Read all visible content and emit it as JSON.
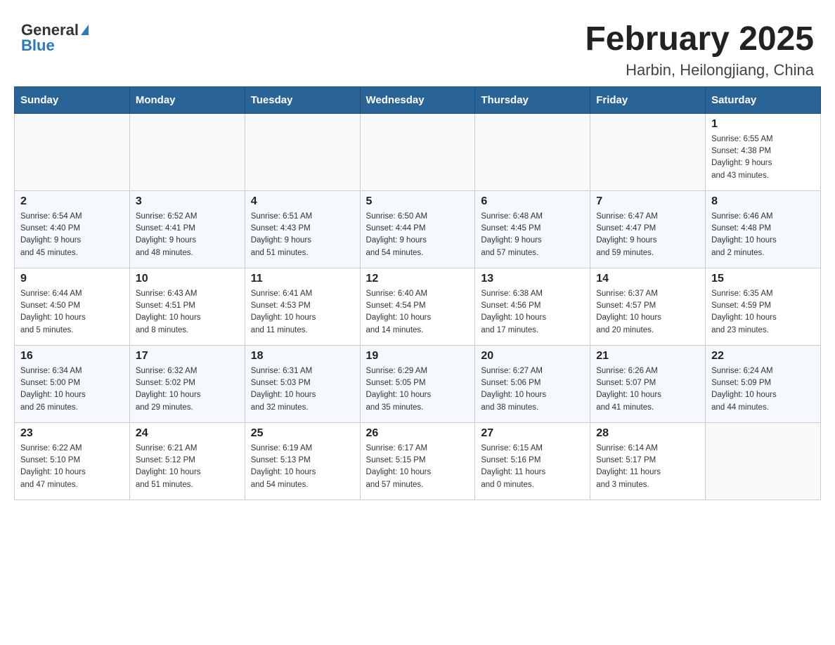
{
  "logo": {
    "general": "General",
    "blue": "Blue"
  },
  "title": {
    "month": "February 2025",
    "location": "Harbin, Heilongjiang, China"
  },
  "weekdays": [
    "Sunday",
    "Monday",
    "Tuesday",
    "Wednesday",
    "Thursday",
    "Friday",
    "Saturday"
  ],
  "weeks": [
    [
      {
        "day": "",
        "info": ""
      },
      {
        "day": "",
        "info": ""
      },
      {
        "day": "",
        "info": ""
      },
      {
        "day": "",
        "info": ""
      },
      {
        "day": "",
        "info": ""
      },
      {
        "day": "",
        "info": ""
      },
      {
        "day": "1",
        "info": "Sunrise: 6:55 AM\nSunset: 4:38 PM\nDaylight: 9 hours\nand 43 minutes."
      }
    ],
    [
      {
        "day": "2",
        "info": "Sunrise: 6:54 AM\nSunset: 4:40 PM\nDaylight: 9 hours\nand 45 minutes."
      },
      {
        "day": "3",
        "info": "Sunrise: 6:52 AM\nSunset: 4:41 PM\nDaylight: 9 hours\nand 48 minutes."
      },
      {
        "day": "4",
        "info": "Sunrise: 6:51 AM\nSunset: 4:43 PM\nDaylight: 9 hours\nand 51 minutes."
      },
      {
        "day": "5",
        "info": "Sunrise: 6:50 AM\nSunset: 4:44 PM\nDaylight: 9 hours\nand 54 minutes."
      },
      {
        "day": "6",
        "info": "Sunrise: 6:48 AM\nSunset: 4:45 PM\nDaylight: 9 hours\nand 57 minutes."
      },
      {
        "day": "7",
        "info": "Sunrise: 6:47 AM\nSunset: 4:47 PM\nDaylight: 9 hours\nand 59 minutes."
      },
      {
        "day": "8",
        "info": "Sunrise: 6:46 AM\nSunset: 4:48 PM\nDaylight: 10 hours\nand 2 minutes."
      }
    ],
    [
      {
        "day": "9",
        "info": "Sunrise: 6:44 AM\nSunset: 4:50 PM\nDaylight: 10 hours\nand 5 minutes."
      },
      {
        "day": "10",
        "info": "Sunrise: 6:43 AM\nSunset: 4:51 PM\nDaylight: 10 hours\nand 8 minutes."
      },
      {
        "day": "11",
        "info": "Sunrise: 6:41 AM\nSunset: 4:53 PM\nDaylight: 10 hours\nand 11 minutes."
      },
      {
        "day": "12",
        "info": "Sunrise: 6:40 AM\nSunset: 4:54 PM\nDaylight: 10 hours\nand 14 minutes."
      },
      {
        "day": "13",
        "info": "Sunrise: 6:38 AM\nSunset: 4:56 PM\nDaylight: 10 hours\nand 17 minutes."
      },
      {
        "day": "14",
        "info": "Sunrise: 6:37 AM\nSunset: 4:57 PM\nDaylight: 10 hours\nand 20 minutes."
      },
      {
        "day": "15",
        "info": "Sunrise: 6:35 AM\nSunset: 4:59 PM\nDaylight: 10 hours\nand 23 minutes."
      }
    ],
    [
      {
        "day": "16",
        "info": "Sunrise: 6:34 AM\nSunset: 5:00 PM\nDaylight: 10 hours\nand 26 minutes."
      },
      {
        "day": "17",
        "info": "Sunrise: 6:32 AM\nSunset: 5:02 PM\nDaylight: 10 hours\nand 29 minutes."
      },
      {
        "day": "18",
        "info": "Sunrise: 6:31 AM\nSunset: 5:03 PM\nDaylight: 10 hours\nand 32 minutes."
      },
      {
        "day": "19",
        "info": "Sunrise: 6:29 AM\nSunset: 5:05 PM\nDaylight: 10 hours\nand 35 minutes."
      },
      {
        "day": "20",
        "info": "Sunrise: 6:27 AM\nSunset: 5:06 PM\nDaylight: 10 hours\nand 38 minutes."
      },
      {
        "day": "21",
        "info": "Sunrise: 6:26 AM\nSunset: 5:07 PM\nDaylight: 10 hours\nand 41 minutes."
      },
      {
        "day": "22",
        "info": "Sunrise: 6:24 AM\nSunset: 5:09 PM\nDaylight: 10 hours\nand 44 minutes."
      }
    ],
    [
      {
        "day": "23",
        "info": "Sunrise: 6:22 AM\nSunset: 5:10 PM\nDaylight: 10 hours\nand 47 minutes."
      },
      {
        "day": "24",
        "info": "Sunrise: 6:21 AM\nSunset: 5:12 PM\nDaylight: 10 hours\nand 51 minutes."
      },
      {
        "day": "25",
        "info": "Sunrise: 6:19 AM\nSunset: 5:13 PM\nDaylight: 10 hours\nand 54 minutes."
      },
      {
        "day": "26",
        "info": "Sunrise: 6:17 AM\nSunset: 5:15 PM\nDaylight: 10 hours\nand 57 minutes."
      },
      {
        "day": "27",
        "info": "Sunrise: 6:15 AM\nSunset: 5:16 PM\nDaylight: 11 hours\nand 0 minutes."
      },
      {
        "day": "28",
        "info": "Sunrise: 6:14 AM\nSunset: 5:17 PM\nDaylight: 11 hours\nand 3 minutes."
      },
      {
        "day": "",
        "info": ""
      }
    ]
  ]
}
